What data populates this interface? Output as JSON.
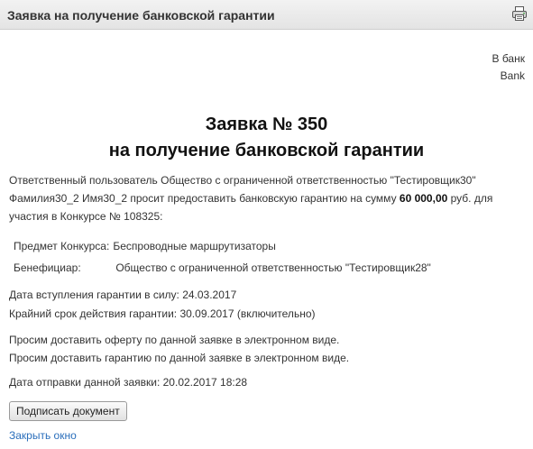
{
  "window": {
    "title": "Заявка на получение банковской гарантии",
    "print_icon": "printer-icon"
  },
  "recipient": {
    "line1": "В банк",
    "line2": "Bank"
  },
  "document": {
    "title_line1": "Заявка № 350",
    "title_line2": "на получение банковской гарантии",
    "intro_part1": "Ответственный пользователь Общество с ограниченной ответственностью \"Тестировщик30\" Фамилия30_2 Имя30_2 просит предоставить банковскую гарантию на сумму ",
    "amount": "60 000,00",
    "intro_part2": " руб. для участия в Конкурсе № 108325:",
    "subject_label": "Предмет Конкурса:",
    "subject_value": "Беспроводные маршрутизаторы",
    "beneficiary_label": "Бенефициар:",
    "beneficiary_value": "Общество с ограниченной ответственностью \"Тестировщик28\"",
    "start_date_line": "Дата вступления гарантии в силу: 24.03.2017",
    "end_date_line": "Крайний срок действия гарантии: 30.09.2017 (включительно)",
    "offer_request": "Просим доставить оферту по данной заявке в электронном виде.",
    "guarantee_request": "Просим доставить гарантию по данной заявке в электронном виде.",
    "sent_date_line": "Дата отправки данной заявки: 20.02.2017 18:28"
  },
  "actions": {
    "sign_button": "Подписать документ",
    "close_link": "Закрыть окно"
  }
}
